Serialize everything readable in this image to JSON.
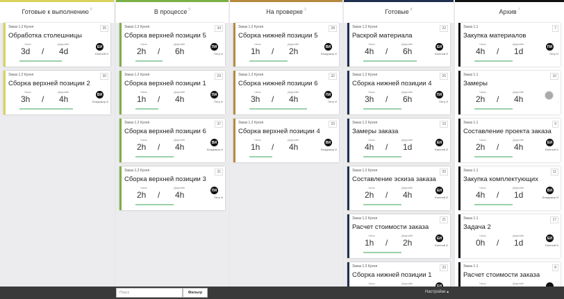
{
  "labels": {
    "hours": "Часы",
    "deadline": "Дедлайн",
    "slash": "/"
  },
  "columns": [
    {
      "title": "Готовые к выполнению",
      "count": "0",
      "color": "#d9d25a",
      "cards": [
        {
          "project": "Заказ 1.2 Кухня",
          "num": "25",
          "title": "Обработка столешницы",
          "hours": "3d",
          "deadline": "4d",
          "initials": "ЕИ",
          "person": "Евгений И",
          "progress": 0.55
        },
        {
          "project": "Заказ 1.2 Кухня",
          "num": "30",
          "title": "Сборка верхней позиции 2",
          "hours": "3h",
          "deadline": "4h",
          "initials": "ВИ",
          "person": "Владимир И",
          "progress": 0.7
        }
      ]
    },
    {
      "title": "В процессе",
      "count": "5",
      "color": "#7ab043",
      "cards": [
        {
          "project": "Заказ 1.2 Кухня",
          "num": "34",
          "title": "Сборка верхней позиции 5",
          "hours": "2h",
          "deadline": "6h",
          "initials": "ПИ",
          "person": "Петр И",
          "progress": 0.35
        },
        {
          "project": "Заказ 1.2 Кухня",
          "num": "29",
          "title": "Сборка верхней позиции 1",
          "hours": "1h",
          "deadline": "4h",
          "initials": "ПИ",
          "person": "Петр И",
          "progress": 0.3
        },
        {
          "project": "Заказ 1.2 Кухня",
          "num": "37",
          "title": "Сборка верхней позиции 6",
          "hours": "2h",
          "deadline": "4h",
          "initials": "ВИ",
          "person": "Владимир И",
          "progress": 0.5
        },
        {
          "project": "Заказ 1.2 Кухня",
          "num": "31",
          "title": "Сборка верхней позиции 3",
          "hours": "2h",
          "deadline": "4h",
          "initials": "ПИ",
          "person": "Петр И",
          "progress": 0.5
        }
      ]
    },
    {
      "title": "На проверке",
      "count": "3",
      "color": "#b58a3e",
      "cards": [
        {
          "project": "Заказ 1.2 Кухня",
          "num": "28",
          "title": "Сборка нижней позиции 5",
          "hours": "1h",
          "deadline": "2h",
          "initials": "ВИ",
          "person": "Владимир И",
          "progress": 0.5
        },
        {
          "project": "Заказ 1.2 Кухня",
          "num": "32",
          "title": "Сборка нижней позиции 6",
          "hours": "3h",
          "deadline": "4h",
          "initials": "ПИ",
          "person": "Петр И",
          "progress": 0.75
        },
        {
          "project": "Заказ 1.2 Кухня",
          "num": "33",
          "title": "Сборка верхней позиции 4",
          "hours": "1h",
          "deadline": "4h",
          "initials": "ВИ",
          "person": "Владимир И",
          "progress": 0.3
        }
      ]
    },
    {
      "title": "Готовые",
      "count": "8",
      "color": "#1e2f4f",
      "cards": [
        {
          "project": "Заказ 1.2 Кухня",
          "num": "22",
          "title": "Раскрой материала",
          "hours": "4h",
          "deadline": "6h",
          "initials": "ЕИ",
          "person": "Евгений И",
          "progress": 0.7
        },
        {
          "project": "Заказ 1.2 Кухня",
          "num": "26",
          "title": "Сборка нижней позиции 4",
          "hours": "3h",
          "deadline": "6h",
          "initials": "ПИ",
          "person": "Петр И",
          "progress": 0.5
        },
        {
          "project": "Заказ 1.2 Кухня",
          "num": "19",
          "title": "Замеры заказа",
          "hours": "4h",
          "deadline": "1d",
          "initials": "ЕИ",
          "person": "Евгений И",
          "progress": 0.5
        },
        {
          "project": "Заказ 1.2 Кухня",
          "num": "20",
          "title": "Составление эскиза заказа",
          "hours": "2h",
          "deadline": "4h",
          "initials": "ЕИ",
          "person": "Евгений И",
          "progress": 0.5
        },
        {
          "project": "Заказ 1.2 Кухня",
          "num": "21",
          "title": "Расчет стоимости заказа",
          "hours": "1h",
          "deadline": "2h",
          "initials": "ЕИ",
          "person": "Евгений И",
          "progress": 0.5
        },
        {
          "project": "Заказ 1.2 Кухня",
          "num": "23",
          "title": "Сборка нижней позиции 1",
          "hours": "",
          "deadline": "",
          "initials": "ЕИ",
          "person": "",
          "progress": 0
        }
      ]
    },
    {
      "title": "Архив",
      "count": "7",
      "color": "#111111",
      "cards": [
        {
          "project": "Заказ 1.1",
          "num": "7",
          "title": "Закупка материалов",
          "hours": "4h",
          "deadline": "1d",
          "initials": "ПИ",
          "person": "Петр И",
          "progress": 0.5
        },
        {
          "project": "Заказ 1.1",
          "num": "10",
          "title": "Замеры",
          "hours": "2h",
          "deadline": "4h",
          "initials": "",
          "person": "-",
          "progress": 0.5,
          "grey": true
        },
        {
          "project": "Заказ 1.1",
          "num": "9",
          "title": "Составление проекта заказа",
          "hours": "2h",
          "deadline": "4h",
          "initials": "ЕИ",
          "person": "Евгений И",
          "progress": 0.5
        },
        {
          "project": "Заказ 1.1",
          "num": "11",
          "title": "Закупка комплектующих",
          "hours": "4h",
          "deadline": "1d",
          "initials": "ВИ",
          "person": "Владимир И",
          "progress": 0.5
        },
        {
          "project": "Заказ 1.1",
          "num": "17",
          "title": "Задача 2",
          "hours": "0h",
          "deadline": "1d",
          "initials": "ЕИ",
          "person": "Евгений И",
          "progress": 0
        },
        {
          "project": "Заказ 1.1",
          "num": "8",
          "title": "Расчет стоимости заказа",
          "hours": "",
          "deadline": "",
          "initials": "",
          "person": "",
          "progress": 0
        }
      ]
    }
  ],
  "footer": {
    "search_placeholder": "Поиск",
    "filter_label": "Фильтр",
    "settings_label": "Настройки ▴"
  }
}
